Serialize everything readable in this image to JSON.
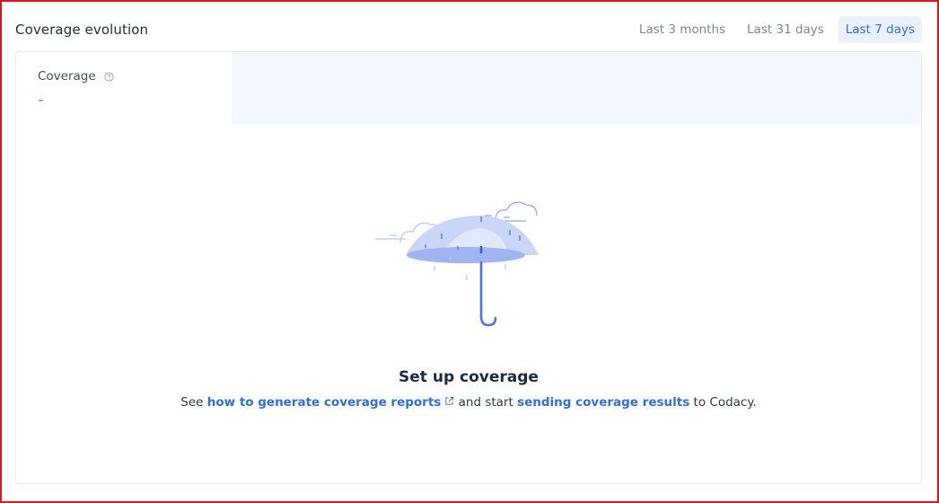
{
  "header": {
    "title": "Coverage evolution",
    "tabs": [
      {
        "label": "Last 3 months",
        "active": false
      },
      {
        "label": "Last 31 days",
        "active": false
      },
      {
        "label": "Last 7 days",
        "active": true
      }
    ]
  },
  "metric": {
    "label": "Coverage",
    "value": "-",
    "help_icon": "question-circle-icon"
  },
  "empty_state": {
    "illustration": "umbrella-rain-illustration",
    "title": "Set up coverage",
    "text_prefix": "See",
    "link1": "how to generate coverage reports",
    "link1_icon": "external-link-icon",
    "text_middle": "and start",
    "link2": "sending coverage results",
    "text_suffix": "to Codacy."
  },
  "colors": {
    "accent": "#2f6fe0",
    "active_tab_bg": "#eaf1fd",
    "chart_bg": "#f3f7fe",
    "frame_border": "#e3131b"
  }
}
